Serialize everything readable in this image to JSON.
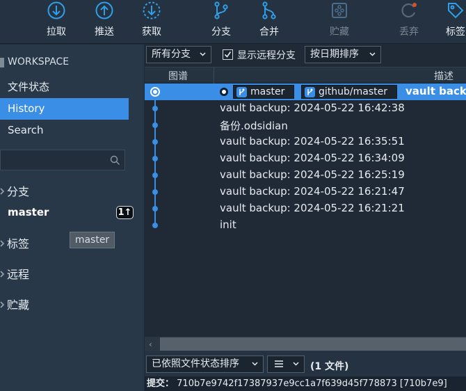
{
  "toolbar": {
    "pull": "拉取",
    "push": "推送",
    "fetch": "获取",
    "branch": "分支",
    "merge": "合并",
    "stash": "贮藏",
    "discard": "丢弃",
    "tag": "标签"
  },
  "sidebar": {
    "workspace_header": "WORKSPACE",
    "items": [
      {
        "label": "文件状态"
      },
      {
        "label": "History"
      },
      {
        "label": "Search"
      }
    ],
    "branches_section": "分支",
    "current_branch": "master",
    "ahead_badge": "1↑",
    "tags_section": "标签",
    "tooltip_tag": "master",
    "remotes_section": "远程",
    "stashes_section": "贮藏"
  },
  "filter_bar": {
    "branch_filter": "所有分支",
    "show_remote_label": "显示远程分支",
    "show_remote_checked": true,
    "sort_order": "按日期排序"
  },
  "columns": {
    "graph": "图谱",
    "description": "描述"
  },
  "commits": [
    {
      "refs": [
        "master",
        "github/master"
      ],
      "message": "vault backup",
      "selected": true
    },
    {
      "message": "vault backup: 2024-05-22 16:42:38"
    },
    {
      "message": "备份.odsidian"
    },
    {
      "message": "vault backup: 2024-05-22 16:35:51"
    },
    {
      "message": "vault backup: 2024-05-22 16:34:09"
    },
    {
      "message": "vault backup: 2024-05-22 16:25:19"
    },
    {
      "message": "vault backup: 2024-05-22 16:21:47"
    },
    {
      "message": "vault backup: 2024-05-22 16:21:21"
    },
    {
      "message": "init"
    }
  ],
  "bottom": {
    "sort_files": "已依照文件状态排序",
    "view_mode_icon": "list-icon",
    "files_count": "(1 文件)"
  },
  "status": {
    "label": "提交：",
    "hash": "710b7e9742f17387937e9cc1a7f639d45f778873 [710b7e9]"
  },
  "colors": {
    "accent": "#3a8ee6",
    "sidebar_bg": "#283848",
    "main_bg": "#1f2a36"
  }
}
